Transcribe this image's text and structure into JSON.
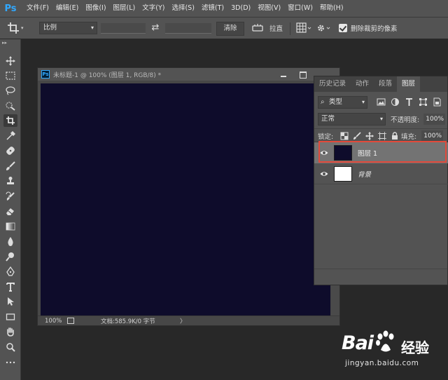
{
  "app": {
    "logo": "Ps"
  },
  "menu": [
    "文件(F)",
    "编辑(E)",
    "图像(I)",
    "图层(L)",
    "文字(Y)",
    "选择(S)",
    "滤镜(T)",
    "3D(D)",
    "视图(V)",
    "窗口(W)",
    "帮助(H)"
  ],
  "options": {
    "ratio_value": "比例",
    "clear_label": "清除",
    "straighten_label": "拉直",
    "delete_cropped_label": "删除裁剪的像素",
    "delete_cropped_checked": true
  },
  "document": {
    "title": "未标题-1 @ 100% (图层 1, RGB/8) *",
    "zoom": "100%",
    "size_info": "文档:585.9K/0 字节",
    "canvas_color": "#0e0c2b"
  },
  "layers_panel": {
    "tabs": [
      "历史记录",
      "动作",
      "段落",
      "图层"
    ],
    "active_tab": "图层",
    "filter_label": "类型",
    "blend_mode": "正常",
    "opacity_label": "不透明度:",
    "opacity_value": "100%",
    "lock_label": "锁定:",
    "fill_label": "填充:",
    "fill_value": "100%",
    "layers": [
      {
        "name": "图层 1",
        "thumb_color": "#0e0c2b",
        "selected": true
      },
      {
        "name": "背景",
        "thumb_color": "#ffffff",
        "selected": false
      }
    ]
  },
  "watermark": {
    "brand": "Bai",
    "suffix": "经验",
    "url": "jingyan.baidu.com"
  },
  "colors": {
    "highlight": "#e24a3b",
    "ps_blue": "#31a8ff"
  }
}
